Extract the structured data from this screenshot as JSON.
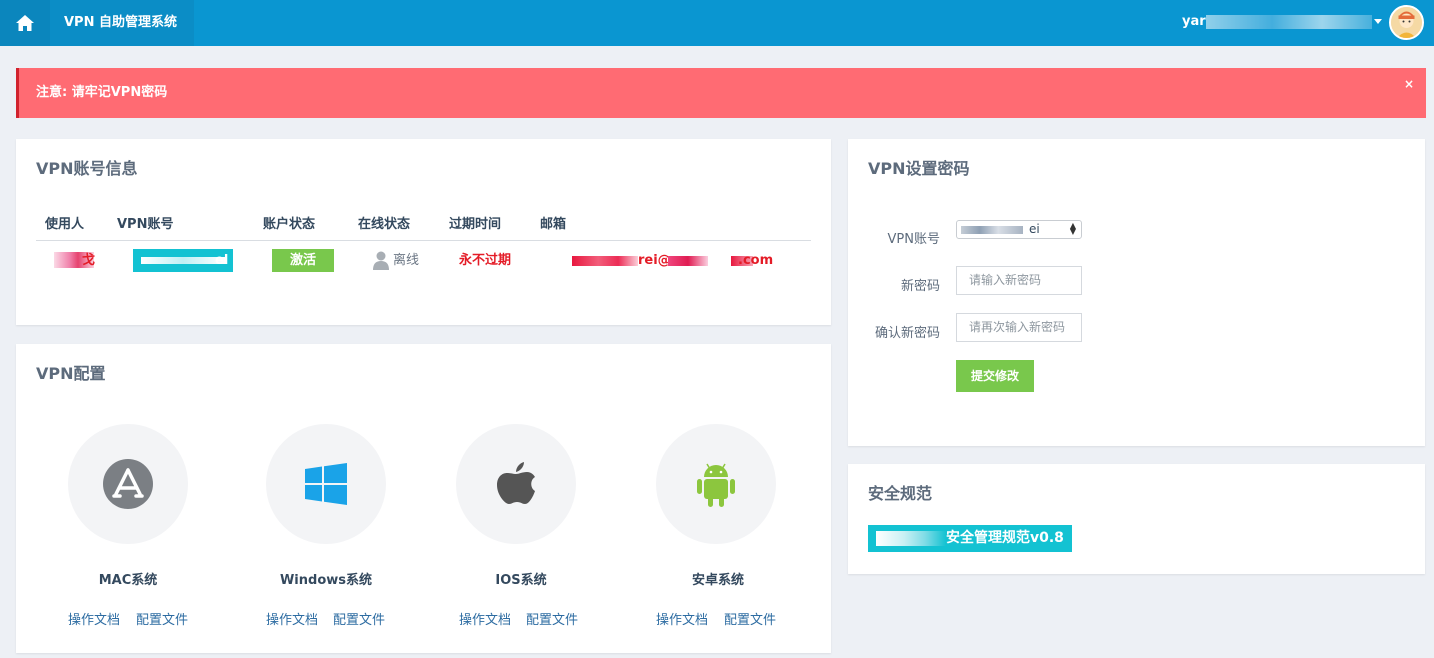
{
  "header": {
    "app_title": "VPN 自助管理系统",
    "user_name": "yar",
    "home_icon": "home-icon",
    "avatar_icon": "user-avatar"
  },
  "alert": {
    "text": "注意: 请牢记VPN密码",
    "close": "×"
  },
  "account_card": {
    "title": "VPN账号信息",
    "columns": [
      "使用人",
      "VPN账号",
      "账户状态",
      "在线状态",
      "过期时间",
      "邮箱"
    ],
    "row": {
      "user_visible": "戈",
      "account_visible": "el",
      "status": "激活",
      "online": "离线",
      "expire": "永不过期",
      "email_visible_1": "rei@",
      "email_visible_2": ".com"
    }
  },
  "config_card": {
    "title": "VPN配置",
    "systems": [
      {
        "name": "MAC系统",
        "icon": "app-store-icon",
        "doc": "操作文档",
        "config": "配置文件"
      },
      {
        "name": "Windows系统",
        "icon": "windows-icon",
        "doc": "操作文档",
        "config": "配置文件"
      },
      {
        "name": "IOS系统",
        "icon": "apple-icon",
        "doc": "操作文档",
        "config": "配置文件"
      },
      {
        "name": "安卓系统",
        "icon": "android-icon",
        "doc": "操作文档",
        "config": "配置文件"
      }
    ]
  },
  "password_card": {
    "title": "VPN设置密码",
    "account_label": "VPN账号",
    "account_value_visible": "ei",
    "new_password_label": "新密码",
    "new_password_placeholder": "请输入新密码",
    "confirm_label": "确认新密码",
    "confirm_placeholder": "请再次输入新密码",
    "submit": "提交修改"
  },
  "security_card": {
    "title": "安全规范",
    "link_visible": "安全管理规范v0.8"
  },
  "colors": {
    "topbar": "#0a96d1",
    "alert": "#ff6b73",
    "success": "#79c84c",
    "danger": "#e41c27",
    "cyan": "#13c2d2",
    "link": "#2d6ca2"
  }
}
